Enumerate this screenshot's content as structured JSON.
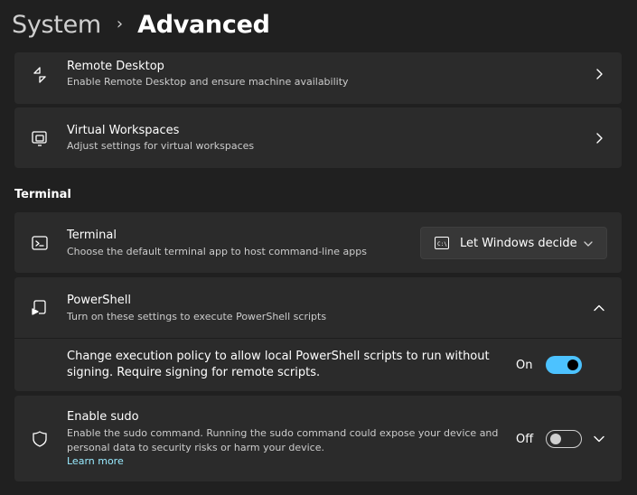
{
  "header": {
    "parent": "System",
    "separator": "›",
    "current": "Advanced"
  },
  "items": {
    "remote_desktop": {
      "title": "Remote Desktop",
      "description": "Enable Remote Desktop and ensure machine availability",
      "icon": "remote-desktop-icon"
    },
    "virtual_workspaces": {
      "title": "Virtual Workspaces",
      "description": "Adjust settings for virtual workspaces",
      "icon": "virtual-workspaces-icon"
    }
  },
  "terminal_section": {
    "label": "Terminal",
    "terminal": {
      "title": "Terminal",
      "description": "Choose the default terminal app to host command-line apps",
      "dropdown_value": "Let Windows decide",
      "icon": "terminal-icon"
    },
    "powershell": {
      "title": "PowerShell",
      "description": "Turn on these settings to execute PowerShell scripts",
      "icon": "powershell-icon",
      "expanded": true,
      "execution_policy": {
        "line1": "Change execution policy to allow local PowerShell scripts to run without",
        "line2": "signing. Require signing for remote scripts.",
        "state_label": "On",
        "state": true
      }
    },
    "sudo": {
      "title": "Enable sudo",
      "line1": "Enable the sudo command. Running the sudo command could expose your device and",
      "line2": "personal data to security risks or harm your device.",
      "link": "Learn more",
      "state_label": "Off",
      "state": false,
      "icon": "shield-icon"
    }
  },
  "colors": {
    "background": "#202020",
    "card": "#2b2b2b",
    "accent": "#4cc2ff",
    "link": "#99ebff"
  }
}
